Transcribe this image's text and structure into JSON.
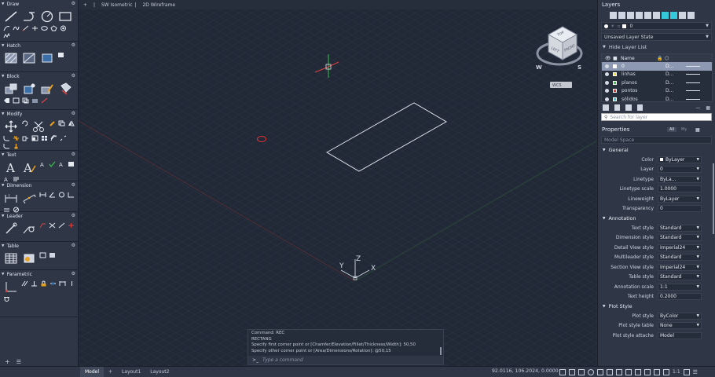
{
  "palette": {
    "sections": [
      {
        "title": "Draw"
      },
      {
        "title": "Hatch"
      },
      {
        "title": "Block"
      },
      {
        "title": "Modify"
      },
      {
        "title": "Text"
      },
      {
        "title": "Dimension"
      },
      {
        "title": "Leader"
      },
      {
        "title": "Table"
      },
      {
        "title": "Parametric"
      }
    ]
  },
  "viewport": {
    "tab_add": "+",
    "view_label": "SW Isometric",
    "visual_style": "2D Wireframe",
    "viewcube": {
      "top": "TOP",
      "left": "LEFT",
      "front": "FRONT",
      "w": "W",
      "s": "S",
      "wcs": "WCS"
    },
    "ucs": {
      "x": "X",
      "y": "Y",
      "z": "Z"
    }
  },
  "command": {
    "history": [
      "Command: REC",
      "RECTANG",
      "Specify first corner point or [Chamfer/Elevation/Fillet/Thickness/Width]: 50,50",
      "Specify other corner point or [Area/Dimensions/Rotation]: @50,15"
    ],
    "prefix": ">_",
    "placeholder": "Type a command"
  },
  "status": {
    "tabs": [
      "Model",
      "+",
      "Layout1",
      "Layout2"
    ],
    "coords": "92.0116, 106.2024, 0.0000",
    "scale": "1:1"
  },
  "layers": {
    "title": "Layers",
    "current_layer": "0",
    "layer_state": "Unsaved Layer State",
    "hide_list": "Hide Layer List",
    "name_col": "Name",
    "rows": [
      {
        "name": "0",
        "color": "#ffffff",
        "lt": "D..."
      },
      {
        "name": "linhas",
        "color": "#e8e230",
        "lt": "D..."
      },
      {
        "name": "planos",
        "color": "#39c24a",
        "lt": "D..."
      },
      {
        "name": "pontos",
        "color": "#e03a3a",
        "lt": "D..."
      },
      {
        "name": "sólidos",
        "color": "#36c9dc",
        "lt": "D..."
      }
    ],
    "search_placeholder": "Search for layer"
  },
  "properties": {
    "title": "Properties",
    "filter_all": "All",
    "filter_my": "My",
    "space": "Model Space",
    "groups": {
      "general": "General",
      "annotation": "Annotation",
      "plot": "Plot Style"
    },
    "general": [
      {
        "label": "Color",
        "value": "ByLayer"
      },
      {
        "label": "Layer",
        "value": "0"
      },
      {
        "label": "Linetype",
        "value": "ByLa..."
      },
      {
        "label": "Linetype scale",
        "value": "1.0000"
      },
      {
        "label": "Lineweight",
        "value": "ByLayer"
      },
      {
        "label": "Transparency",
        "value": "0"
      }
    ],
    "annotation": [
      {
        "label": "Text style",
        "value": "Standard"
      },
      {
        "label": "Dimension style",
        "value": "Standard"
      },
      {
        "label": "Detail View style",
        "value": "Imperial24"
      },
      {
        "label": "Multileader style",
        "value": "Standard"
      },
      {
        "label": "Section View style",
        "value": "Imperial24"
      },
      {
        "label": "Table style",
        "value": "Standard"
      },
      {
        "label": "Annotation scale",
        "value": "1:1"
      },
      {
        "label": "Text height",
        "value": "0.2000"
      }
    ],
    "plot": [
      {
        "label": "Plot style",
        "value": "ByColor"
      },
      {
        "label": "Plot style table",
        "value": "None"
      },
      {
        "label": "Plot style attache",
        "value": "Model"
      }
    ]
  }
}
